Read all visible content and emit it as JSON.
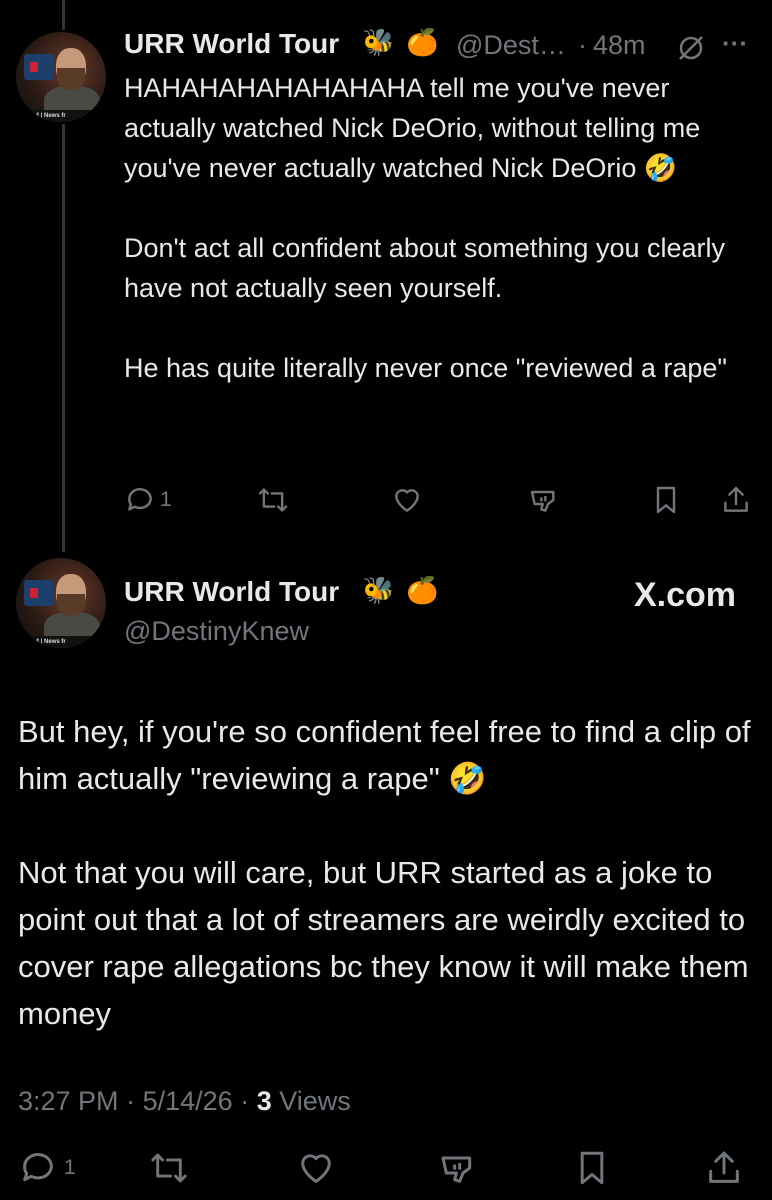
{
  "reply_tweet": {
    "display_name": "URR World Tour",
    "name_emojis": [
      "🐝",
      "🍊"
    ],
    "handle": "@Dest…",
    "separator": "·",
    "timestamp": "48m",
    "more_icon_text": "···",
    "avatar_ticker": "ss 3-4 | News fr",
    "text_paragraphs": [
      "HAHAHAHAHAHAHAHA tell me you've never actually watched Nick DeOrio, without telling me you've never actually watched Nick DeOrio 🤣",
      "Don't act all confident about something you clearly have not actually seen yourself.",
      "He has quite literally never once \"reviewed a rape\""
    ],
    "actions": {
      "reply_count": "1"
    }
  },
  "main_tweet": {
    "display_name": "URR World Tour",
    "name_emojis": [
      "🐝",
      "🍊"
    ],
    "handle": "@DestinyKnew",
    "avatar_ticker": "ss 3-4 | News fr",
    "watermark": "X.com",
    "text_paragraphs": [
      "But hey, if you're so confident feel free to find a clip of him actually \"reviewing a rape\" 🤣",
      "Not that you will care, but URR started as a joke to point out that a lot of streamers are weirdly excited to cover rape allegations bc they know it will make them money"
    ],
    "meta": {
      "time": "3:27 PM",
      "date": "5/14/26",
      "views_count": "3",
      "views_label": "Views",
      "separator": "·"
    },
    "actions": {
      "reply_count": "1"
    }
  },
  "colors": {
    "background": "#000000",
    "text": "#e7e9ea",
    "muted": "#71767b",
    "thread_line": "#333639"
  },
  "icons": [
    "reply-icon",
    "retweet-icon",
    "like-icon",
    "views-icon",
    "bookmark-icon",
    "share-icon",
    "grok-icon",
    "more-icon"
  ]
}
